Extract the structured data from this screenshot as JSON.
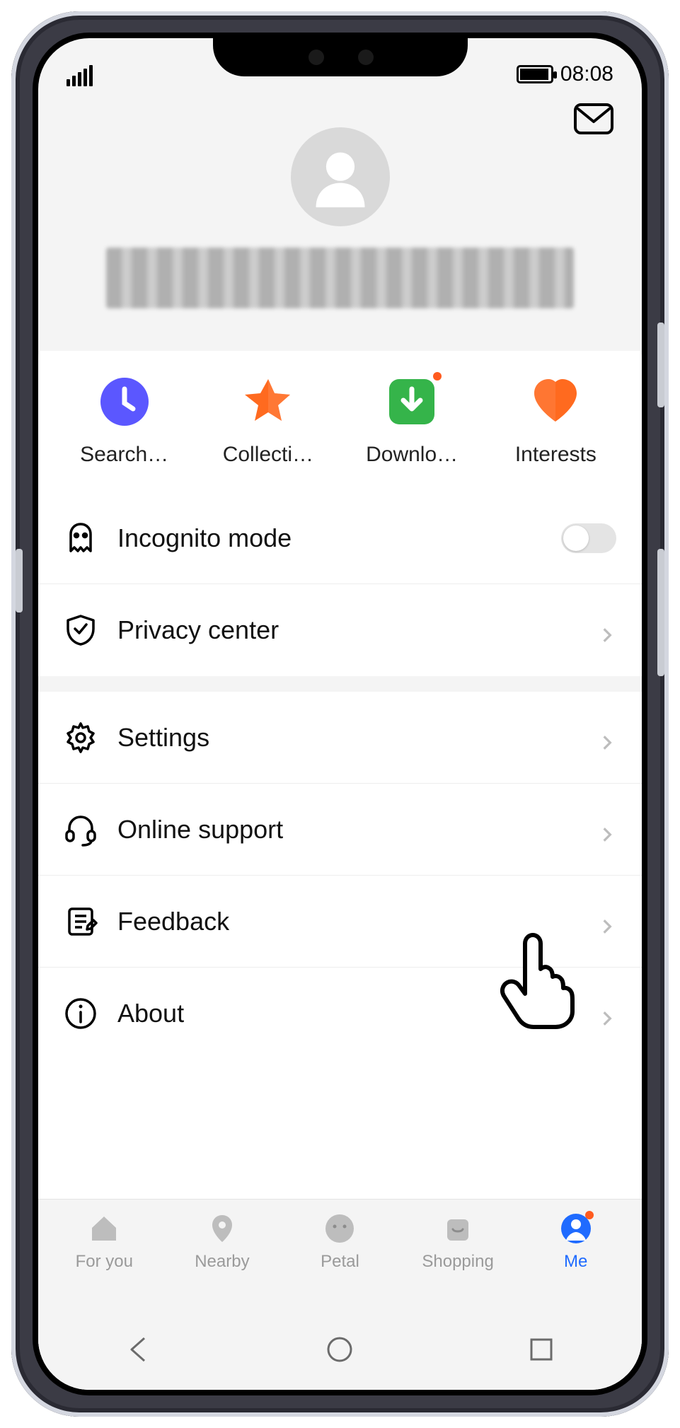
{
  "status": {
    "time": "08:08"
  },
  "profile": {
    "username_obscured": true
  },
  "quick": [
    {
      "label": "Search…",
      "icon": "clock",
      "color": "#5b57ff"
    },
    {
      "label": "Collecti…",
      "icon": "star",
      "color": "#ff6a1f"
    },
    {
      "label": "Downlo…",
      "icon": "download",
      "color": "#35b44a",
      "dot": true
    },
    {
      "label": "Interests",
      "icon": "heart",
      "color": "#ff6a1f"
    }
  ],
  "rows_a": [
    {
      "label": "Incognito mode",
      "icon": "ghost",
      "control": "toggle",
      "value": false
    },
    {
      "label": "Privacy center",
      "icon": "shield",
      "control": "chevron"
    }
  ],
  "rows_b": [
    {
      "label": "Settings",
      "icon": "gear",
      "control": "chevron"
    },
    {
      "label": "Online support",
      "icon": "headset",
      "control": "chevron"
    },
    {
      "label": "Feedback",
      "icon": "note",
      "control": "chevron"
    },
    {
      "label": "About",
      "icon": "info",
      "control": "chevron"
    }
  ],
  "bottom_nav": [
    {
      "label": "For you",
      "icon": "home"
    },
    {
      "label": "Nearby",
      "icon": "pin"
    },
    {
      "label": "Petal",
      "icon": "face"
    },
    {
      "label": "Shopping",
      "icon": "bag"
    },
    {
      "label": "Me",
      "icon": "person",
      "active": true,
      "dot": true
    }
  ],
  "cursor": {
    "target_row": "Settings"
  }
}
